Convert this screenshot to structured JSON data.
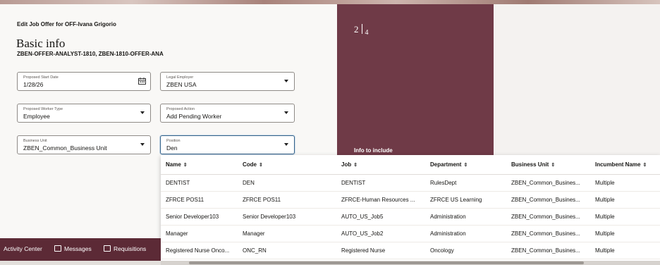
{
  "header": {
    "edit_title": "Edit Job Offer for OFF-Ivana Grigorio",
    "page_title": "Basic info",
    "subtitle": "ZBEN-OFFER-ANALYST-1810, ZBEN-1810-OFFER-ANA"
  },
  "form": {
    "start_date": {
      "label": "Proposed Start Date",
      "value": "1/28/26"
    },
    "legal_employer": {
      "label": "Legal Employer",
      "value": "ZBEN USA"
    },
    "worker_type": {
      "label": "Proposed Worker Type",
      "value": "Employee"
    },
    "action": {
      "label": "Proposed Action",
      "value": "Add Pending Worker"
    },
    "business_unit": {
      "label": "Business Unit",
      "value": "ZBEN_Common_Business Unit"
    },
    "position": {
      "label": "Position",
      "value": "Den"
    }
  },
  "progress": {
    "current": "2",
    "total": "4",
    "info_label": "Info to include"
  },
  "dropdown": {
    "columns": [
      "Name",
      "Code",
      "Job",
      "Department",
      "Business Unit",
      "Incumbent Name"
    ],
    "rows": [
      [
        "DENTIST",
        "DEN",
        "DENTIST",
        "RulesDept",
        "ZBEN_Common_Busines...",
        "Multiple"
      ],
      [
        "ZFRCE POS11",
        "ZFRCE POS11",
        "ZFRCE-Human Resources ...",
        "ZFRCE US Learning",
        "ZBEN_Common_Busines...",
        "Multiple"
      ],
      [
        "Senior Developer103",
        "Senior Developer103",
        "AUTO_US_Job5",
        "Administration",
        "ZBEN_Common_Busines...",
        "Multiple"
      ],
      [
        "Manager",
        "Manager",
        "AUTO_US_Job2",
        "Administration",
        "ZBEN_Common_Busines...",
        "Multiple"
      ],
      [
        "Registered Nurse Onco...",
        "ONC_RN",
        "Registered Nurse",
        "Oncology",
        "ZBEN_Common_Busines...",
        "Multiple"
      ]
    ]
  },
  "bottom_nav": {
    "activity_center": "Activity Center",
    "messages": "Messages",
    "requisitions": "Requisitions"
  },
  "colors": {
    "brand": "#6f3a47",
    "nav": "#5c2a36"
  }
}
